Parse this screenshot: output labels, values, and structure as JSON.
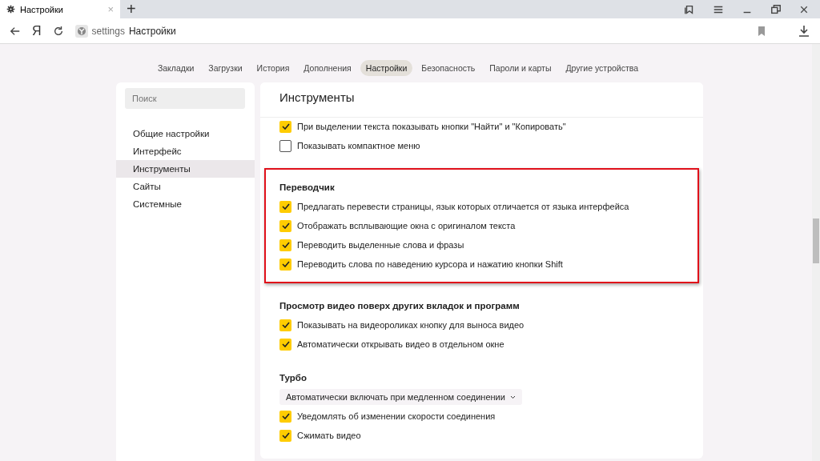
{
  "tab": {
    "title": "Настройки",
    "close": "×"
  },
  "new_tab": "+",
  "address": {
    "scheme": "settings",
    "title": "Настройки"
  },
  "logo": "Я",
  "nav": [
    {
      "label": "Закладки",
      "selected": false
    },
    {
      "label": "Загрузки",
      "selected": false
    },
    {
      "label": "История",
      "selected": false
    },
    {
      "label": "Дополнения",
      "selected": false
    },
    {
      "label": "Настройки",
      "selected": true
    },
    {
      "label": "Безопасность",
      "selected": false
    },
    {
      "label": "Пароли и карты",
      "selected": false
    },
    {
      "label": "Другие устройства",
      "selected": false
    }
  ],
  "sidebar": {
    "search": {
      "placeholder": "Поиск"
    },
    "items": [
      {
        "label": "Общие настройки",
        "selected": false
      },
      {
        "label": "Интерфейс",
        "selected": false
      },
      {
        "label": "Инструменты",
        "selected": true
      },
      {
        "label": "Сайты",
        "selected": false
      },
      {
        "label": "Системные",
        "selected": false
      }
    ]
  },
  "main": {
    "title": "Инструменты",
    "sections": [
      {
        "highlighted": false,
        "items": [
          {
            "kind": "checkbox",
            "label": "При выделении текста показывать кнопки \"Найти\" и \"Копировать\"",
            "checked": true
          },
          {
            "kind": "checkbox",
            "label": "Показывать компактное меню",
            "checked": false
          }
        ]
      },
      {
        "title": "Переводчик",
        "highlighted": true,
        "items": [
          {
            "kind": "checkbox",
            "label": "Предлагать перевести страницы, язык которых отличается от языка интерфейса",
            "checked": true
          },
          {
            "kind": "checkbox",
            "label": "Отображать всплывающие окна с оригиналом текста",
            "checked": true
          },
          {
            "kind": "checkbox",
            "label": "Переводить выделенные слова и фразы",
            "checked": true
          },
          {
            "kind": "checkbox",
            "label": "Переводить слова по наведению курсора и нажатию кнопки Shift",
            "checked": true
          }
        ]
      },
      {
        "title": "Просмотр видео поверх других вкладок и программ",
        "highlighted": false,
        "items": [
          {
            "kind": "checkbox",
            "label": "Показывать на видеороликах кнопку для выноса видео",
            "checked": true
          },
          {
            "kind": "checkbox",
            "label": "Автоматически открывать видео в отдельном окне",
            "checked": true
          }
        ]
      },
      {
        "title": "Турбо",
        "highlighted": false,
        "items": [
          {
            "kind": "select",
            "value": "Автоматически включать при медленном соединении"
          },
          {
            "kind": "checkbox",
            "label": "Уведомлять об изменении скорости соединения",
            "checked": true
          },
          {
            "kind": "checkbox",
            "label": "Сжимать видео",
            "checked": true
          }
        ]
      }
    ]
  }
}
